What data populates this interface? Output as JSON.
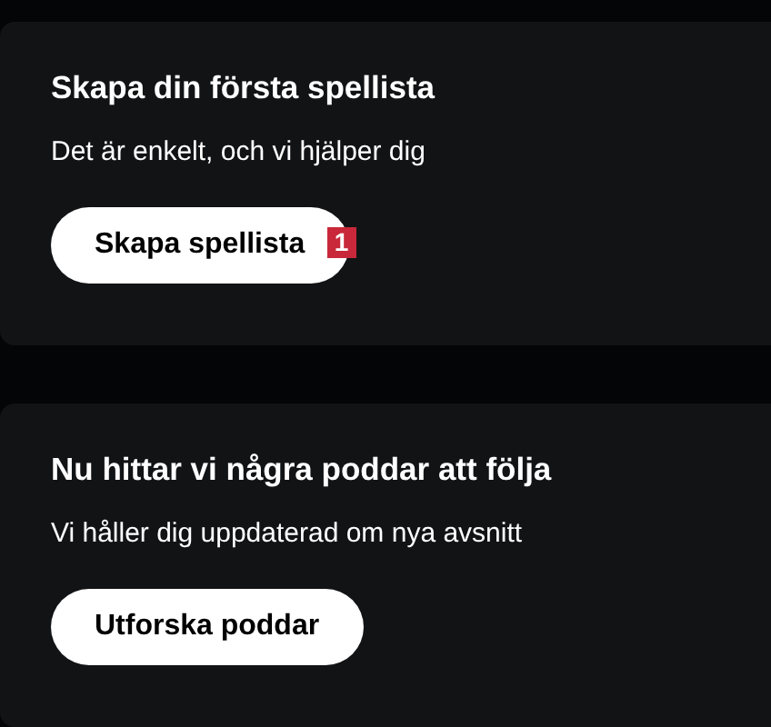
{
  "cards": [
    {
      "title": "Skapa din första spellista",
      "subtitle": "Det är enkelt, och vi hjälper dig",
      "button": "Skapa spellista",
      "badge": "1"
    },
    {
      "title": "Nu hittar vi några poddar att följa",
      "subtitle": "Vi håller dig uppdaterad om nya avsnitt",
      "button": "Utforska poddar"
    }
  ]
}
